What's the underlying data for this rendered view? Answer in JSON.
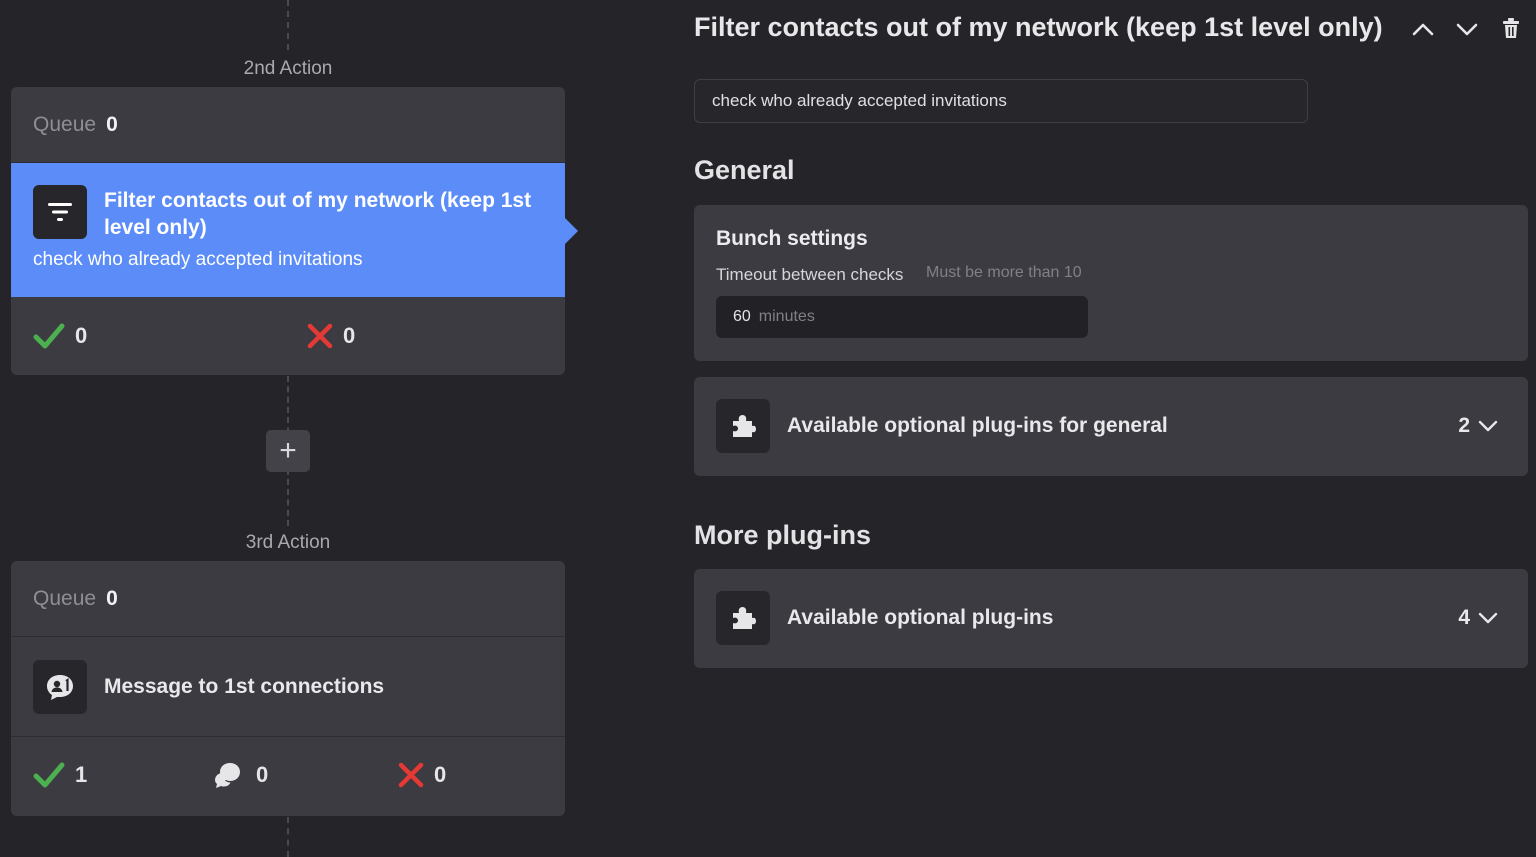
{
  "workflow": {
    "actions": [
      {
        "label": "2nd Action",
        "queue_label": "Queue",
        "queue_count": "0",
        "title": "Filter contacts out of my network (keep 1st level only)",
        "subtitle": "check who already accepted invitations",
        "icon": "filter-icon",
        "stats": {
          "success": "0",
          "failed": "0"
        }
      },
      {
        "label": "3rd Action",
        "queue_label": "Queue",
        "queue_count": "0",
        "title": "Message to 1st connections",
        "icon": "message-person-icon",
        "stats": {
          "success": "1",
          "replied": "0",
          "failed": "0"
        }
      }
    ],
    "add_button": "+"
  },
  "detail": {
    "title": "Filter contacts out of my network (keep 1st level only)",
    "description_value": "check who already accepted invitations",
    "general_heading": "General",
    "bunch": {
      "title": "Bunch settings",
      "timeout_label": "Timeout between checks",
      "timeout_hint": "Must be more than 10",
      "timeout_value": "60",
      "timeout_unit": "minutes"
    },
    "general_plugins": {
      "label": "Available optional plug-ins for general",
      "count": "2"
    },
    "more_heading": "More plug-ins",
    "more_plugins": {
      "label": "Available optional plug-ins",
      "count": "4"
    }
  },
  "colors": {
    "background": "#252529",
    "card": "#3b3b41",
    "accent": "#5b8cf7",
    "success": "#4caf50",
    "failed": "#e53935"
  }
}
